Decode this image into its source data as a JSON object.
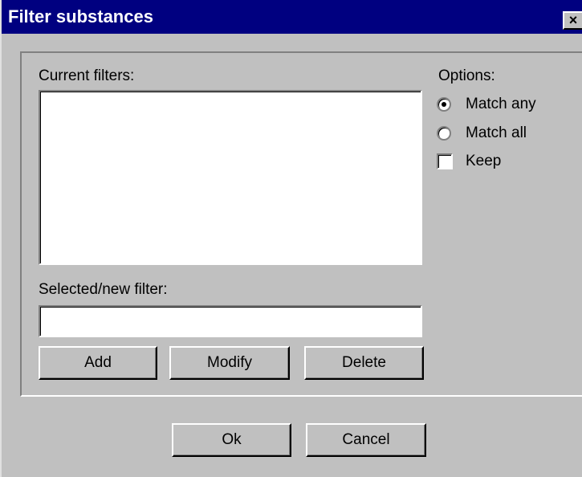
{
  "window": {
    "title": "Filter substances",
    "close_glyph": "×"
  },
  "filters": {
    "current_label": "Current filters:",
    "items": [],
    "selected_label": "Selected/new filter:",
    "selected_value": ""
  },
  "options": {
    "label": "Options:",
    "match_any": "Match any",
    "match_all": "Match all",
    "keep": "Keep",
    "match_any_checked": true,
    "match_all_checked": false,
    "keep_checked": false
  },
  "buttons": {
    "add": "Add",
    "modify": "Modify",
    "delete": "Delete",
    "ok": "Ok",
    "cancel": "Cancel"
  },
  "colors": {
    "titlebar": "#000080",
    "face": "#c0c0c0",
    "field": "#ffffff"
  }
}
